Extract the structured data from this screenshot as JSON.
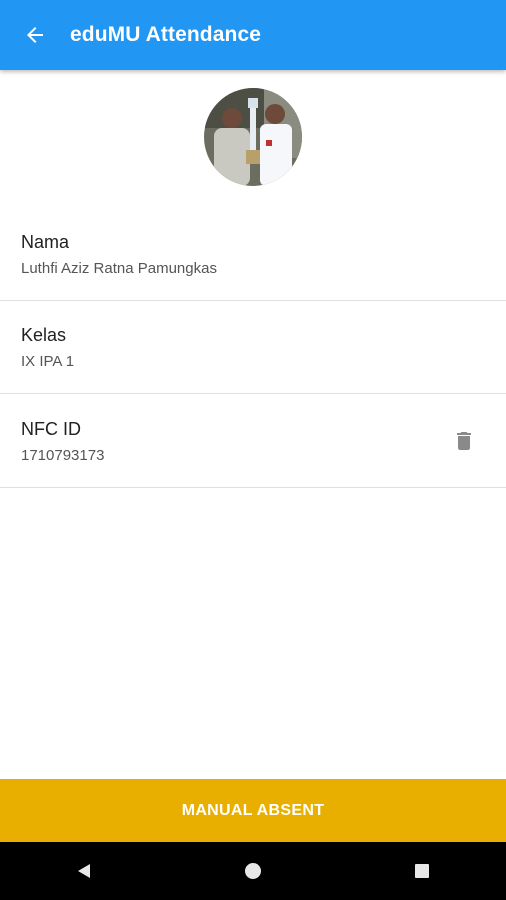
{
  "appbar": {
    "title": "eduMU Attendance",
    "back_icon": "arrow-back-icon",
    "color": "#2196f3"
  },
  "profile": {
    "avatar": "student-photo"
  },
  "fields": [
    {
      "label": "Nama",
      "value": "Luthfi Aziz Ratna Pamungkas"
    },
    {
      "label": "Kelas",
      "value": "IX IPA 1"
    },
    {
      "label": "NFC ID",
      "value": "1710793173",
      "action_icon": "delete-icon"
    }
  ],
  "footer": {
    "button_label": "MANUAL ABSENT",
    "color": "#e8af00"
  },
  "navbar": {
    "icons": [
      "back-triangle-icon",
      "home-circle-icon",
      "recents-square-icon"
    ]
  }
}
